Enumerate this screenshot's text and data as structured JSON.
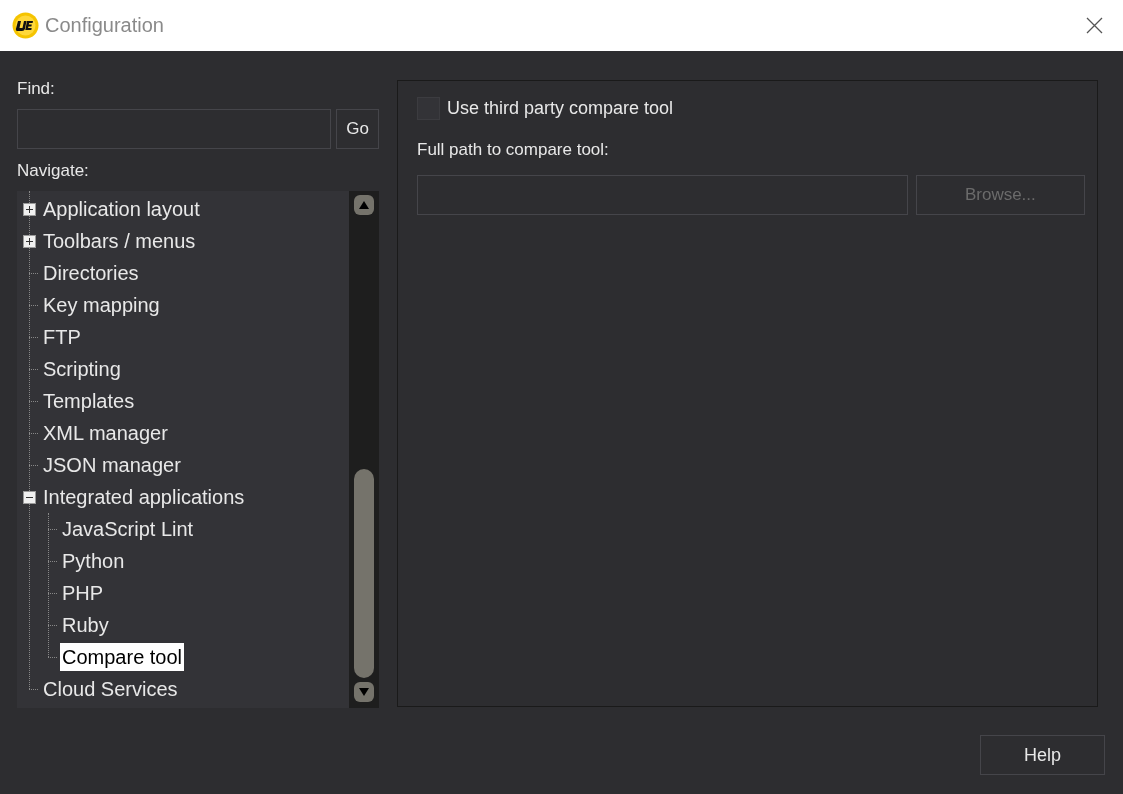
{
  "window": {
    "title": "Configuration"
  },
  "find": {
    "label": "Find:",
    "go_button": "Go"
  },
  "navigate": {
    "label": "Navigate:",
    "items": [
      {
        "label": "Application layout",
        "expanded": false,
        "selected": false
      },
      {
        "label": "Toolbars / menus",
        "expanded": false,
        "selected": false
      },
      {
        "label": "Directories",
        "selected": false
      },
      {
        "label": "Key mapping",
        "selected": false
      },
      {
        "label": "FTP",
        "selected": false
      },
      {
        "label": "Scripting",
        "selected": false
      },
      {
        "label": "Templates",
        "selected": false
      },
      {
        "label": "XML manager",
        "selected": false
      },
      {
        "label": "JSON manager",
        "selected": false
      },
      {
        "label": "Integrated applications",
        "expanded": true,
        "selected": false,
        "children": [
          {
            "label": "JavaScript Lint",
            "selected": false
          },
          {
            "label": "Python",
            "selected": false
          },
          {
            "label": "PHP",
            "selected": false
          },
          {
            "label": "Ruby",
            "selected": false
          },
          {
            "label": "Compare tool",
            "selected": true
          }
        ]
      },
      {
        "label": "Cloud Services",
        "selected": false
      }
    ]
  },
  "panel": {
    "use_third_party": {
      "label": "Use third party compare tool",
      "checked": false
    },
    "path_label": "Full path to compare tool:",
    "browse_button": {
      "label": "Browse...",
      "disabled": true
    }
  },
  "buttons": {
    "help": "Help"
  }
}
